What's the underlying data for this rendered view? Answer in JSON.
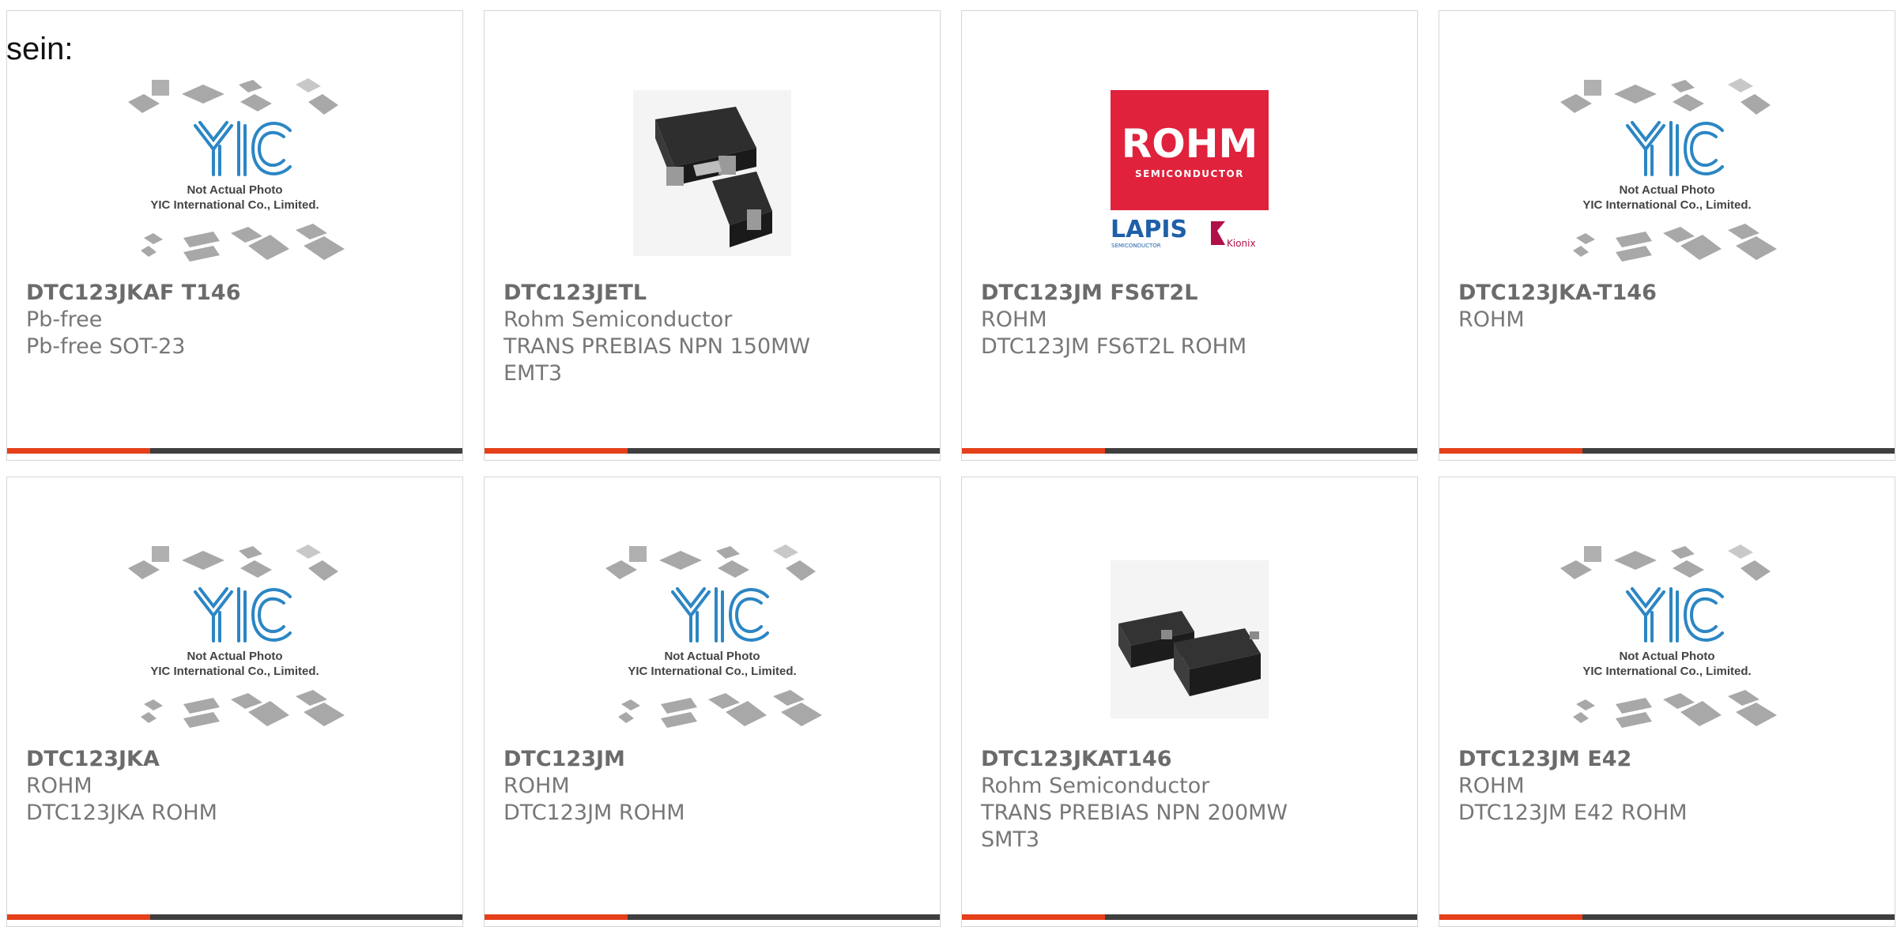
{
  "intro_text": "sein:",
  "colors": {
    "accent": "#e4401b",
    "bar": "#3f3f3f",
    "card_border": "#d6d6d6",
    "text": "#777777"
  },
  "placeholder": {
    "caption_line1": "Not Actual Photo",
    "caption_line2": "YIC International Co., Limited."
  },
  "rohm_logo": {
    "brand": "ROHM",
    "sub": "SEMICONDUCTOR",
    "lapis": "LAPIS",
    "lapis_sub": "SEMICONDUCTOR",
    "kionix": "Kionix"
  },
  "products": [
    {
      "title": "DTC123JKAF T146",
      "line1": "Pb-free",
      "line2": "Pb-free SOT-23",
      "image": "placeholder"
    },
    {
      "title": "DTC123JETL",
      "line1": "Rohm Semiconductor",
      "line2": "TRANS PREBIAS NPN 150MW EMT3",
      "image": "chip-emt3"
    },
    {
      "title": "DTC123JM FS6T2L",
      "line1": "ROHM",
      "line2": "DTC123JM FS6T2L ROHM",
      "image": "rohm-logo"
    },
    {
      "title": "DTC123JKA-T146",
      "line1": "ROHM",
      "line2": "",
      "image": "placeholder"
    },
    {
      "title": "DTC123JKA",
      "line1": "ROHM",
      "line2": "DTC123JKA ROHM",
      "image": "placeholder"
    },
    {
      "title": "DTC123JM",
      "line1": "ROHM",
      "line2": "DTC123JM ROHM",
      "image": "placeholder"
    },
    {
      "title": "DTC123JKAT146",
      "line1": "Rohm Semiconductor",
      "line2": "TRANS PREBIAS NPN 200MW SMT3",
      "image": "chip-smt3"
    },
    {
      "title": "DTC123JM E42",
      "line1": "ROHM",
      "line2": "DTC123JM E42 ROHM",
      "image": "placeholder"
    }
  ]
}
